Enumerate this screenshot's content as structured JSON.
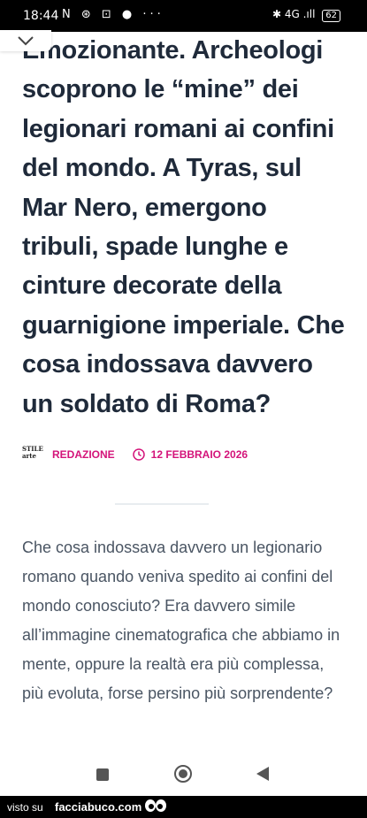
{
  "status_bar": {
    "time": "18:44",
    "left_icons": "N ⊛ ⊡ ● ···",
    "right_icons": "✱ 4G .ıll",
    "battery": "62"
  },
  "article": {
    "headline": "Emozionante. Archeologi scoprono le “mine” dei legionari romani ai confini del mondo. A Tyras, sul Mar Nero, emergono tribuli, spade lunghe e cinture decorate della guarnigione imperiale. Che cosa indossava davvero un soldato di Roma?",
    "logo_text": "STILE arte",
    "author": "REDAZIONE",
    "date": "12 FEBBRAIO 2026",
    "lead": "Che cosa indossava davvero un legionario romano quando veniva spedito ai confini del mondo conosciuto? Era davvero simile all’immagine cinematografica che abbiamo in mente, oppure la realtà era più complessa, più evoluta, forse persino più sorprendente?"
  },
  "colors": {
    "accent": "#d4147a",
    "headline": "#1f2a3a",
    "body": "#4a5563"
  },
  "footer": {
    "visto_label": "visto su",
    "site": "facciabuco.com"
  }
}
